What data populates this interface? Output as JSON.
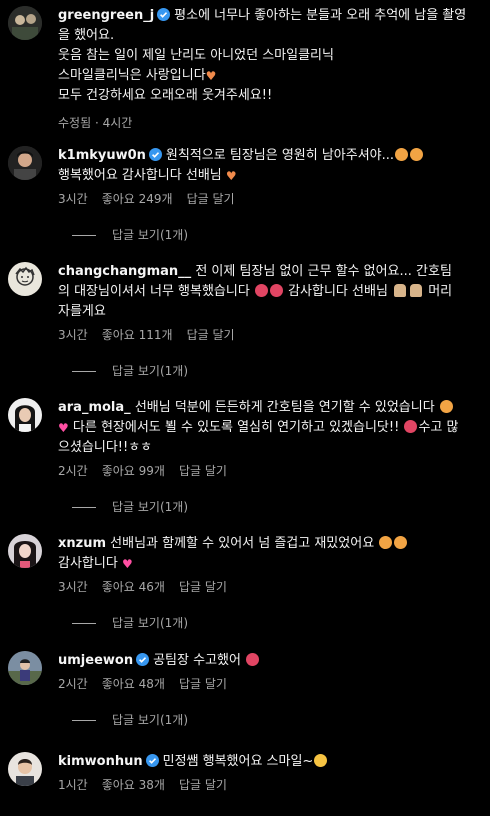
{
  "caption": {
    "username": "greengreen_j",
    "lines": [
      "평소에 너무나 좋아하는 분들과 오래 추억에 남을 촬영을 했어요.",
      "웃음 참는 일이 제일 난리도 아니었던 스마일클리닉",
      "스마일클리닉은 사랑입니다",
      "모두 건강하세요 오래오래 웃겨주세요!!"
    ],
    "edited_label": "수정됨",
    "time": "4시간"
  },
  "comments": [
    {
      "username": "k1mkyuw0n",
      "verified": true,
      "text_1": "원칙적으로 팀장님은 영원히 남아주셔야...",
      "text_2": "행복했어요 감사합니다 선배님",
      "time": "3시간",
      "likes": "좋아요 249개",
      "reply_action": "답글 달기",
      "view_replies": "답글 보기(1개)"
    },
    {
      "username": "changchangman__",
      "verified": false,
      "text_1": "전 이제 팀장님 없이 근무 할수 없어요... 간호팀의 대장님이셔서 너무 행복했습니다",
      "text_2": "감사합니다 선배님",
      "text_3": "머리 자를게요",
      "time": "3시간",
      "likes": "좋아요 111개",
      "reply_action": "답글 달기",
      "view_replies": "답글 보기(1개)"
    },
    {
      "username": "ara_mola_",
      "verified": false,
      "text_1": "선배님 덕분에 든든하게 간호팀을 연기할 수 있었습니다",
      "text_2": "다른 현장에서도 뵐 수 있도록 열심히 연기하고 있겠습니닷!!",
      "text_3": "수고 많으셨습니다!!ㅎㅎ",
      "time": "2시간",
      "likes": "좋아요 99개",
      "reply_action": "답글 달기",
      "view_replies": "답글 보기(1개)"
    },
    {
      "username": "xnzum",
      "verified": false,
      "text_1": "선배님과 함께할 수 있어서 넘 즐겁고 재밌었어요",
      "text_2": "감사합니다",
      "time": "3시간",
      "likes": "좋아요 46개",
      "reply_action": "답글 달기",
      "view_replies": "답글 보기(1개)"
    },
    {
      "username": "umjeewon",
      "verified": true,
      "text_1": "공팀장 수고했어",
      "time": "2시간",
      "likes": "좋아요 48개",
      "reply_action": "답글 달기",
      "view_replies": "답글 보기(1개)"
    },
    {
      "username": "kimwonhun",
      "verified": true,
      "text_1": "민정쌤 행복했어요 스마일~",
      "time": "1시간",
      "likes": "좋아요 38개",
      "reply_action": "답글 달기"
    }
  ],
  "colors": {
    "background": "#000000",
    "text": "#f5f5f5",
    "secondary": "#a8a8a8",
    "verified": "#3797f0"
  }
}
